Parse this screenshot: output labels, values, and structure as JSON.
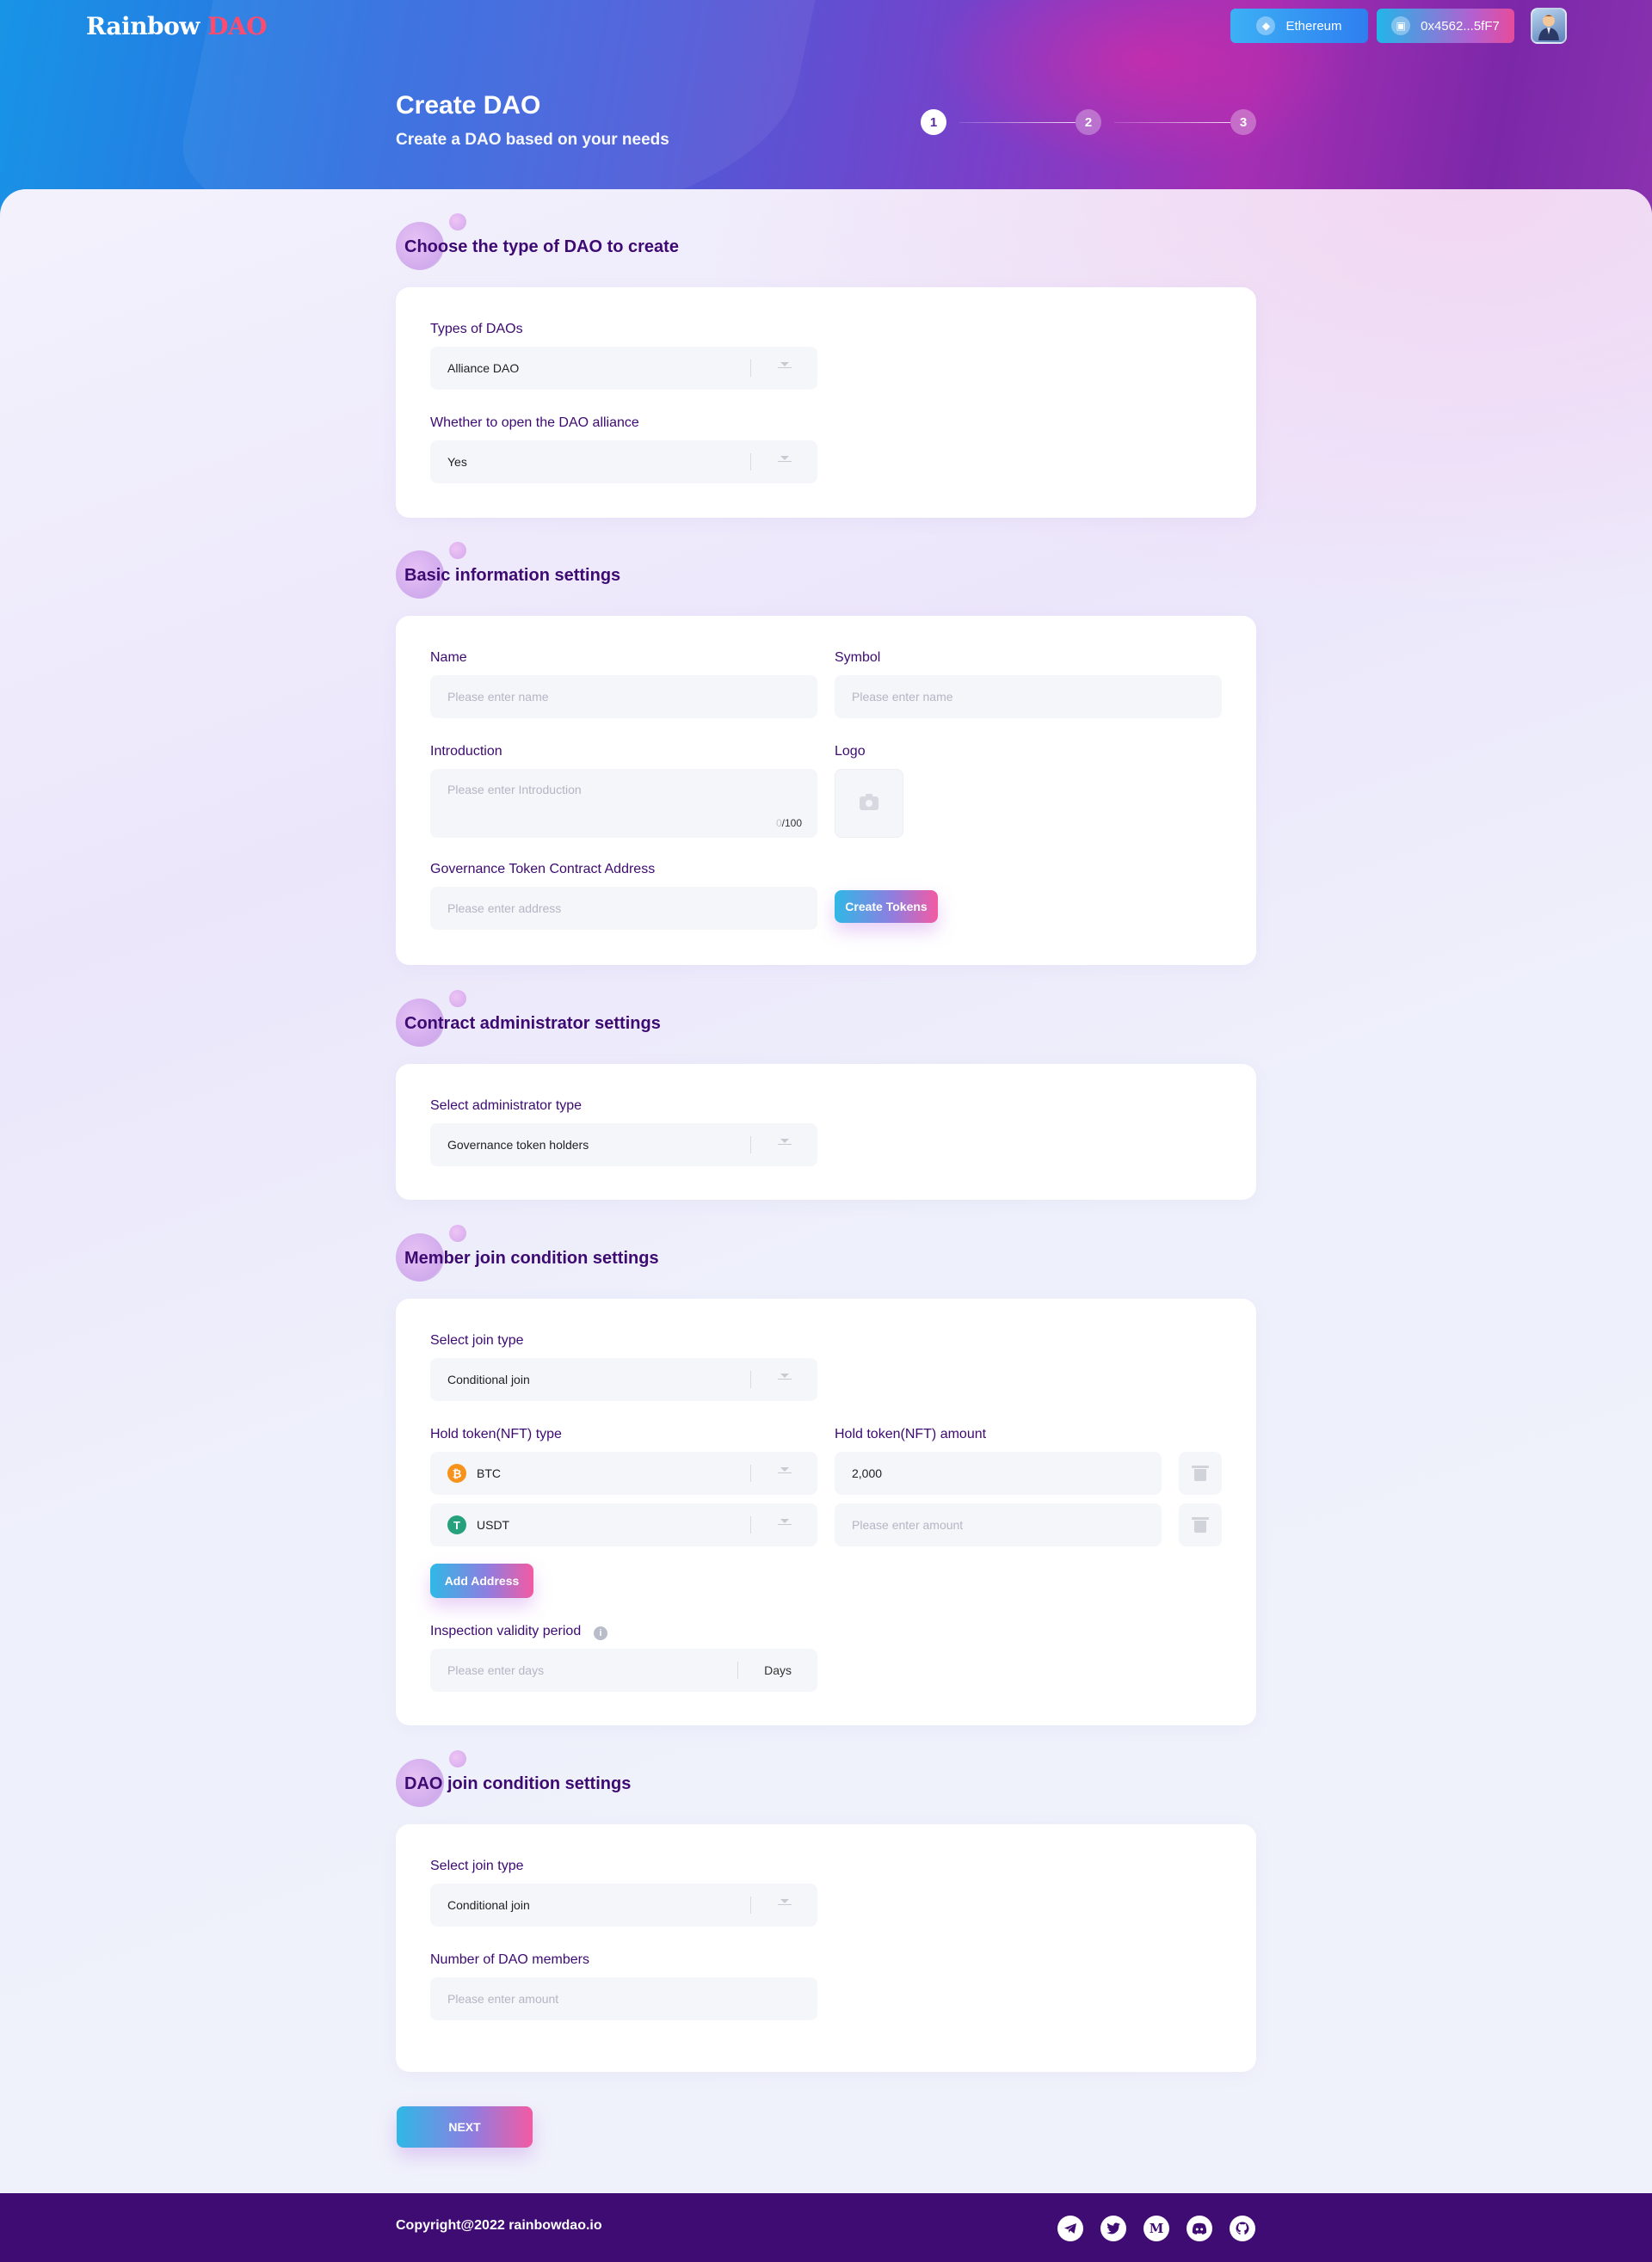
{
  "header": {
    "logo": {
      "main": "Rainbow",
      "accent": "DAO"
    },
    "network_button": "Ethereum",
    "wallet_button": "0x4562...5fF7",
    "page_title": "Create DAO",
    "page_subtitle": "Create a DAO based on your needs",
    "steps": [
      "1",
      "2",
      "3"
    ],
    "current_step": 1
  },
  "section_type": {
    "title": "Choose the type of DAO to create",
    "types_label": "Types of DAOs",
    "types_value": "Alliance DAO",
    "open_label": "Whether to open the DAO alliance",
    "open_value": "Yes"
  },
  "section_basic": {
    "title": "Basic information settings",
    "name_label": "Name",
    "name_placeholder": "Please enter name",
    "symbol_label": "Symbol",
    "symbol_placeholder": "Please enter name",
    "intro_label": "Introduction",
    "intro_placeholder": "Please enter Introduction",
    "intro_count": "0",
    "intro_max": "100",
    "logo_label": "Logo",
    "gov_label": "Governance Token Contract Address",
    "gov_placeholder": "Please enter address",
    "create_tokens_button": "Create Tokens"
  },
  "section_admin": {
    "title": "Contract administrator settings",
    "admin_label": "Select administrator type",
    "admin_value": "Governance token holders"
  },
  "section_member": {
    "title": "Member join condition settings",
    "join_label": "Select join type",
    "join_value": "Conditional join",
    "hold_type_label": "Hold token(NFT) type",
    "hold_amount_label": "Hold token(NFT) amount",
    "tokens": [
      {
        "symbol": "BTC",
        "icon": "btc-icon",
        "glyph": "₿",
        "amount": "2,000",
        "amount_placeholder": ""
      },
      {
        "symbol": "USDT",
        "icon": "usdt-icon",
        "glyph": "T",
        "amount": "",
        "amount_placeholder": "Please enter amount"
      }
    ],
    "add_address_button": "Add Address",
    "period_label": "Inspection validity period",
    "period_placeholder": "Please enter days",
    "period_suffix": "Days"
  },
  "section_dao": {
    "title": "DAO join condition settings",
    "join_label": "Select join type",
    "join_value": "Conditional join",
    "members_label": "Number of DAO members",
    "members_placeholder": "Please enter amount"
  },
  "next_button": "NEXT",
  "footer": {
    "copyright": "Copyright@2022 rainbowdao.io",
    "social": [
      "telegram-icon",
      "twitter-icon",
      "medium-icon",
      "discord-icon",
      "github-icon"
    ]
  },
  "colors": {
    "primary_text": "#3d0a72",
    "footer_bg": "#3f0c73",
    "gradient_start": "#2fb8e6",
    "gradient_end": "#f35aa3"
  }
}
